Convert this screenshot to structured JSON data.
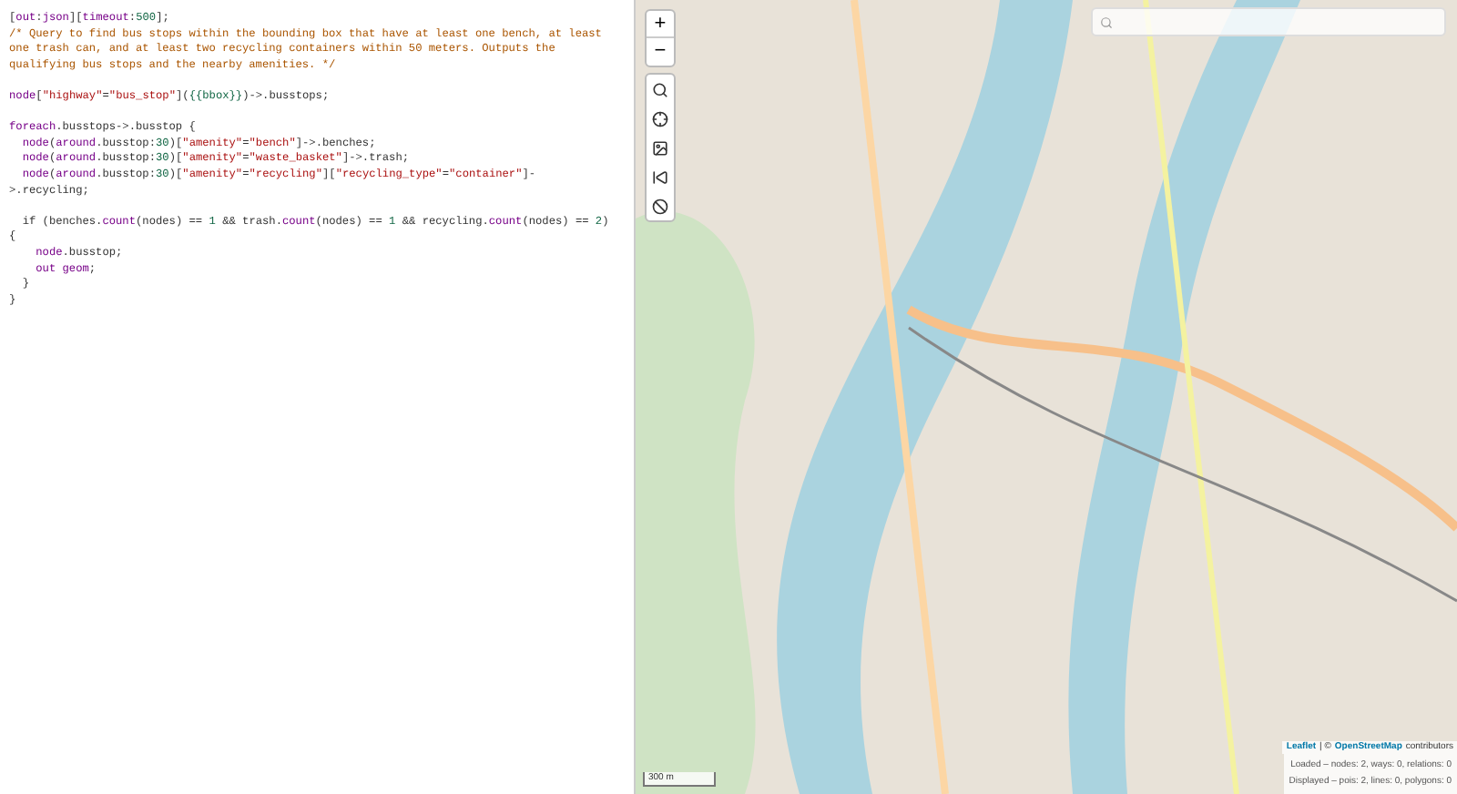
{
  "editor": {
    "lines": [
      {
        "kind": "code",
        "tokens": [
          {
            "t": "[",
            "kind": "p"
          },
          {
            "t": "out",
            "kind": "kw"
          },
          {
            "t": ":",
            "kind": "p"
          },
          {
            "t": "json",
            "kind": "kw"
          },
          {
            "t": "][",
            "kind": "p"
          },
          {
            "t": "timeout",
            "kind": "kw"
          },
          {
            "t": ":",
            "kind": "p"
          },
          {
            "t": "500",
            "kind": "num"
          },
          {
            "t": "];",
            "kind": "p"
          }
        ]
      },
      {
        "kind": "code",
        "tokens": [
          {
            "t": "/* Query to find bus stops within the bounding box that have at least one bench, at least",
            "kind": "cm"
          }
        ]
      },
      {
        "kind": "code",
        "tokens": [
          {
            "t": "one trash can, and at least two recycling containers within 50 meters. Outputs the",
            "kind": "cm"
          }
        ]
      },
      {
        "kind": "code",
        "tokens": [
          {
            "t": "qualifying bus stops and the nearby amenities. */",
            "kind": "cm"
          }
        ]
      },
      {
        "kind": "blank"
      },
      {
        "kind": "code",
        "tokens": [
          {
            "t": "node",
            "kind": "kw"
          },
          {
            "t": "[",
            "kind": "p"
          },
          {
            "t": "\"highway\"",
            "kind": "str"
          },
          {
            "t": "=",
            "kind": "p"
          },
          {
            "t": "\"bus_stop\"",
            "kind": "str"
          },
          {
            "t": "](",
            "kind": "p"
          },
          {
            "t": "{{bbox}}",
            "kind": "num"
          },
          {
            "t": ")->.busstops;",
            "kind": "p"
          }
        ]
      },
      {
        "kind": "blank"
      },
      {
        "kind": "code",
        "tokens": [
          {
            "t": "foreach",
            "kind": "kw"
          },
          {
            "t": ".busstops->.busstop {",
            "kind": "p"
          }
        ]
      },
      {
        "kind": "code",
        "tokens": [
          {
            "t": "  node",
            "kind": "kw"
          },
          {
            "t": "(",
            "kind": "p"
          },
          {
            "t": "around",
            "kind": "kw"
          },
          {
            "t": ".busstop:",
            "kind": "p"
          },
          {
            "t": "30",
            "kind": "num"
          },
          {
            "t": ")[",
            "kind": "p"
          },
          {
            "t": "\"amenity\"",
            "kind": "str"
          },
          {
            "t": "=",
            "kind": "p"
          },
          {
            "t": "\"bench\"",
            "kind": "str"
          },
          {
            "t": "]->.benches;",
            "kind": "p"
          }
        ]
      },
      {
        "kind": "code",
        "tokens": [
          {
            "t": "  node",
            "kind": "kw"
          },
          {
            "t": "(",
            "kind": "p"
          },
          {
            "t": "around",
            "kind": "kw"
          },
          {
            "t": ".busstop:",
            "kind": "p"
          },
          {
            "t": "30",
            "kind": "num"
          },
          {
            "t": ")[",
            "kind": "p"
          },
          {
            "t": "\"amenity\"",
            "kind": "str"
          },
          {
            "t": "=",
            "kind": "p"
          },
          {
            "t": "\"waste_basket\"",
            "kind": "str"
          },
          {
            "t": "]->.trash;",
            "kind": "p"
          }
        ]
      },
      {
        "kind": "code",
        "tokens": [
          {
            "t": "  node",
            "kind": "kw"
          },
          {
            "t": "(",
            "kind": "p"
          },
          {
            "t": "around",
            "kind": "kw"
          },
          {
            "t": ".busstop:",
            "kind": "p"
          },
          {
            "t": "30",
            "kind": "num"
          },
          {
            "t": ")[",
            "kind": "p"
          },
          {
            "t": "\"amenity\"",
            "kind": "str"
          },
          {
            "t": "=",
            "kind": "p"
          },
          {
            "t": "\"recycling\"",
            "kind": "str"
          },
          {
            "t": "][",
            "kind": "p"
          },
          {
            "t": "\"recycling_type\"",
            "kind": "str"
          },
          {
            "t": "=",
            "kind": "p"
          },
          {
            "t": "\"container\"",
            "kind": "str"
          },
          {
            "t": "]-",
            "kind": "p"
          }
        ]
      },
      {
        "kind": "code",
        "tokens": [
          {
            "t": ">.recycling;",
            "kind": "p"
          }
        ]
      },
      {
        "kind": "blank"
      },
      {
        "kind": "code",
        "tokens": [
          {
            "t": "  if (benches.",
            "kind": "p"
          },
          {
            "t": "count",
            "kind": "kw"
          },
          {
            "t": "(nodes) == ",
            "kind": "p"
          },
          {
            "t": "1",
            "kind": "num"
          },
          {
            "t": " && trash.",
            "kind": "p"
          },
          {
            "t": "count",
            "kind": "kw"
          },
          {
            "t": "(nodes) == ",
            "kind": "p"
          },
          {
            "t": "1",
            "kind": "num"
          },
          {
            "t": " && recycling.",
            "kind": "p"
          },
          {
            "t": "count",
            "kind": "kw"
          },
          {
            "t": "(nodes) == ",
            "kind": "p"
          },
          {
            "t": "2",
            "kind": "num"
          },
          {
            "t": ")",
            "kind": "p"
          }
        ]
      },
      {
        "kind": "code",
        "tokens": [
          {
            "t": "{",
            "kind": "p"
          }
        ]
      },
      {
        "kind": "code",
        "tokens": [
          {
            "t": "    node",
            "kind": "kw"
          },
          {
            "t": ".busstop;",
            "kind": "p"
          }
        ]
      },
      {
        "kind": "code",
        "tokens": [
          {
            "t": "    out geom",
            "kind": "kw"
          },
          {
            "t": ";",
            "kind": "p"
          }
        ]
      },
      {
        "kind": "code",
        "tokens": [
          {
            "t": "  }",
            "kind": "p"
          }
        ]
      },
      {
        "kind": "code",
        "tokens": [
          {
            "t": "}",
            "kind": "p"
          }
        ]
      }
    ]
  },
  "map": {
    "zoom_in": "+",
    "zoom_out": "−",
    "scale": "300 m",
    "attribution": {
      "leaflet": "Leaflet",
      "separator": "| ©",
      "osm": "OpenStreetMap",
      "rest": "contributors"
    },
    "status": [
      "Loaded – nodes: 2, ways: 0, relations: 0",
      "Displayed – pois: 2, lines: 0, polygons: 0"
    ]
  }
}
